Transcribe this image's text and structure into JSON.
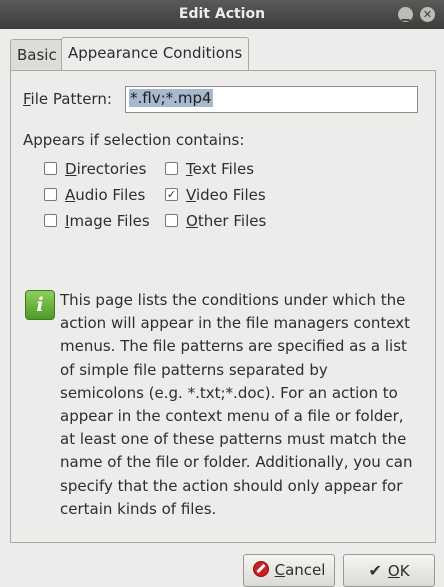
{
  "window": {
    "title": "Edit Action"
  },
  "tabs": [
    {
      "label": "Basic"
    },
    {
      "label": "Appearance Conditions"
    }
  ],
  "file_pattern": {
    "label_mnemonic": "F",
    "label_rest": "ile Pattern:",
    "value": "*.flv;*.mp4"
  },
  "appears_label": "Appears if selection contains:",
  "checkboxes": [
    {
      "mnemonic": "D",
      "rest": "irectories",
      "checked": false
    },
    {
      "mnemonic": "T",
      "rest": "ext Files",
      "checked": false
    },
    {
      "mnemonic": "A",
      "rest": "udio Files",
      "checked": false
    },
    {
      "mnemonic": "V",
      "rest": "ideo Files",
      "checked": true
    },
    {
      "mnemonic": "I",
      "rest": "mage Files",
      "checked": false
    },
    {
      "mnemonic": "O",
      "rest": "ther Files",
      "checked": false
    }
  ],
  "info_text": "This page lists the conditions under which the action will appear in the file managers context menus. The file patterns are specified as a list of simple file patterns separated by semicolons (e.g. *.txt;*.doc). For an action to appear in the context menu of a file or folder, at least one of these patterns must match the name of the file or folder. Additionally, you can specify that the action should only appear for certain kinds of files.",
  "buttons": {
    "cancel": {
      "mnemonic": "C",
      "rest": "ancel"
    },
    "ok": {
      "mnemonic": "O",
      "rest": "K"
    }
  },
  "colors": {
    "titlebar": "#3c3c3a",
    "selection": "#a8b8ce",
    "info_icon": "#4e9a28",
    "cancel_icon": "#cc1f1f"
  },
  "icons": [
    "minimize-icon",
    "close-icon",
    "info-icon",
    "cancel-icon",
    "checkmark-icon"
  ]
}
